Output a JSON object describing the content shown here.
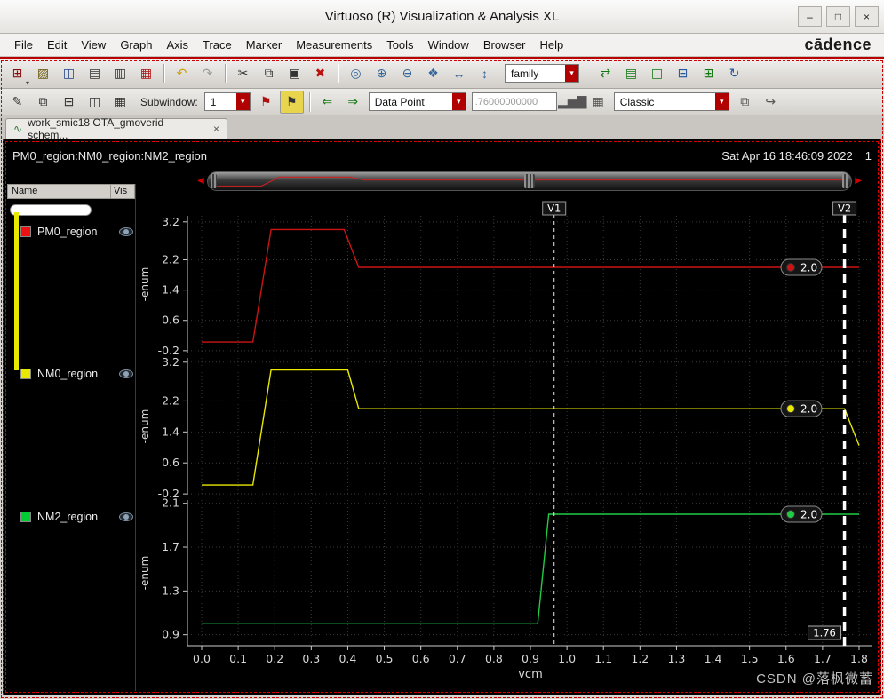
{
  "window": {
    "title": "Virtuoso (R) Visualization & Analysis XL",
    "minimize": "–",
    "maximize": "□",
    "close": "×"
  },
  "menubar": {
    "items": [
      "File",
      "Edit",
      "View",
      "Graph",
      "Axis",
      "Trace",
      "Marker",
      "Measurements",
      "Tools",
      "Window",
      "Browser",
      "Help"
    ],
    "brand": "cādence"
  },
  "toolbar1": {
    "buttons": [
      {
        "name": "new-waveform-button",
        "glyph": "⊞",
        "color": "#8a1010",
        "caret": true
      },
      {
        "name": "open-results-button",
        "glyph": "▨",
        "color": "#6b5a10"
      },
      {
        "name": "save-button",
        "glyph": "◫",
        "color": "#224488"
      },
      {
        "name": "print-button",
        "glyph": "▤",
        "color": "#333333"
      },
      {
        "name": "export-image-button",
        "glyph": "▥",
        "color": "#333333"
      },
      {
        "name": "calculator-button",
        "glyph": "▦",
        "color": "#aa1111"
      },
      {
        "type": "sep"
      },
      {
        "name": "undo-button",
        "glyph": "↶",
        "color": "#c8a000"
      },
      {
        "name": "redo-button",
        "glyph": "↷",
        "color": "#9a9a9a"
      },
      {
        "type": "sep"
      },
      {
        "name": "cut-button",
        "glyph": "✂",
        "color": "#333333"
      },
      {
        "name": "copy-button",
        "glyph": "⧉",
        "color": "#333333"
      },
      {
        "name": "paste-button",
        "glyph": "▣",
        "color": "#333333"
      },
      {
        "name": "delete-button",
        "glyph": "✖",
        "color": "#bb1111"
      },
      {
        "type": "sep"
      },
      {
        "name": "zoom-fit-button",
        "glyph": "◎",
        "color": "#336699"
      },
      {
        "name": "zoom-in-button",
        "glyph": "⊕",
        "color": "#336699"
      },
      {
        "name": "zoom-out-button",
        "glyph": "⊖",
        "color": "#336699"
      },
      {
        "name": "pan-button",
        "glyph": "❖",
        "color": "#336699"
      },
      {
        "name": "zoom-x-button",
        "glyph": "↔",
        "color": "#336699"
      },
      {
        "name": "zoom-y-button",
        "glyph": "↕",
        "color": "#336699"
      }
    ],
    "family_label": "family",
    "right_buttons": [
      {
        "name": "swap-axes-button",
        "glyph": "⇄",
        "color": "#117711"
      },
      {
        "name": "strip-mode-button",
        "glyph": "▤",
        "color": "#117711"
      },
      {
        "name": "split-strips-button",
        "glyph": "◫",
        "color": "#117711"
      },
      {
        "name": "overlay-mode-button",
        "glyph": "⊟",
        "color": "#225599"
      },
      {
        "name": "new-subwindow-button",
        "glyph": "⊞",
        "color": "#117711"
      },
      {
        "name": "refresh-plot-button",
        "glyph": "↻",
        "color": "#225599"
      }
    ]
  },
  "toolbar2": {
    "group_a": [
      {
        "name": "probe-tool-button",
        "glyph": "✎",
        "color": "#333333"
      },
      {
        "name": "cards-view-button",
        "glyph": "⧉",
        "color": "#333333"
      },
      {
        "name": "horizontal-split-button",
        "glyph": "⊟",
        "color": "#333333"
      },
      {
        "name": "vertical-split-button",
        "glyph": "◫",
        "color": "#333333"
      },
      {
        "name": "window-grid-button",
        "glyph": "▦",
        "color": "#333333"
      }
    ],
    "subwindow_label": "Subwindow:",
    "subwindow_value": "1",
    "group_b": [
      {
        "name": "vertical-marker-button",
        "glyph": "⚑",
        "color": "#aa1111"
      },
      {
        "name": "horizontal-marker-button",
        "glyph": "⚑",
        "color": "#333333",
        "bgcolor": "#e8d44d"
      }
    ],
    "group_c": [
      {
        "name": "previous-point-button",
        "glyph": "⇐",
        "color": "#117711"
      },
      {
        "name": "next-point-button",
        "glyph": "⇒",
        "color": "#117711"
      }
    ],
    "mode_dropdown": "Data Point",
    "value_field": ".76000000000",
    "group_d": [
      {
        "name": "histogram-button",
        "glyph": "▂▅▇",
        "color": "#555555"
      },
      {
        "name": "calculator-tool-button",
        "glyph": "▦",
        "color": "#555555"
      }
    ],
    "style_dropdown": "Classic",
    "group_e": [
      {
        "name": "copy-graph-button",
        "glyph": "⧉",
        "color": "#555555"
      },
      {
        "name": "export-graph-button",
        "glyph": "↪",
        "color": "#555555"
      }
    ]
  },
  "tab": {
    "label": "work_smic18 OTA_gmoverid schem...",
    "close": "×"
  },
  "graph": {
    "header_title": "PM0_region:NM0_region:NM2_region",
    "header_date": "Sat Apr 16 18:46:09 2022",
    "header_page": "1",
    "panel": {
      "name_col": "Name",
      "vis_col": "Vis",
      "signals": [
        {
          "name": "PM0_region",
          "color": "#ee1111"
        },
        {
          "name": "NM0_region",
          "color": "#e8e800"
        },
        {
          "name": "NM2_region",
          "color": "#00cc33"
        }
      ]
    }
  },
  "watermark": "CSDN @落枫微蓄",
  "chart_data": {
    "type": "line",
    "xlabel": "vcm",
    "x_ticks": [
      "0.0",
      "0.1",
      "0.2",
      "0.3",
      "0.4",
      "0.5",
      "0.6",
      "0.7",
      "0.8",
      "0.9",
      "1.0",
      "1.1",
      "1.2",
      "1.3",
      "1.4",
      "1.5",
      "1.6",
      "1.7",
      "1.8"
    ],
    "x_range": [
      0,
      1.8
    ],
    "grid": true,
    "v1_label": "V1",
    "v2_label": "V2",
    "v1_x": 0.965,
    "v2_x": 1.76,
    "v2_value": "1.76",
    "strips": [
      {
        "name": "PM0_region",
        "color": "#cc1414",
        "ylabel": "-enum",
        "y_ticks": [
          3.2,
          2.2,
          1.4,
          0.6,
          -0.2
        ],
        "y_range": [
          -0.25,
          3.36
        ],
        "points": [
          [
            0,
            0.03
          ],
          [
            0.14,
            0.03
          ],
          [
            0.19,
            3.0
          ],
          [
            0.39,
            3.0
          ],
          [
            0.43,
            2.0
          ],
          [
            1.8,
            2.0
          ]
        ],
        "marker_label": "2.0",
        "marker_y": 2.0
      },
      {
        "name": "NM0_region",
        "color": "#e8e800",
        "ylabel": "-enum",
        "y_ticks": [
          3.2,
          2.2,
          1.4,
          0.6,
          -0.2
        ],
        "y_range": [
          -0.22,
          3.31
        ],
        "points": [
          [
            0,
            0.03
          ],
          [
            0.14,
            0.03
          ],
          [
            0.19,
            3.0
          ],
          [
            0.4,
            3.0
          ],
          [
            0.43,
            2.0
          ],
          [
            1.76,
            2.0
          ],
          [
            1.8,
            1.05
          ]
        ],
        "marker_label": "2.0",
        "marker_y": 2.0
      },
      {
        "name": "NM2_region",
        "color": "#21cc44",
        "ylabel": "-enum",
        "y_ticks": [
          2.1,
          1.7,
          1.3,
          0.9
        ],
        "y_range": [
          0.8,
          2.13
        ],
        "points": [
          [
            0,
            1.0
          ],
          [
            0.92,
            1.0
          ],
          [
            0.95,
            2.0
          ],
          [
            1.8,
            2.0
          ]
        ],
        "marker_label": "2.0",
        "marker_y": 2.0
      }
    ]
  }
}
